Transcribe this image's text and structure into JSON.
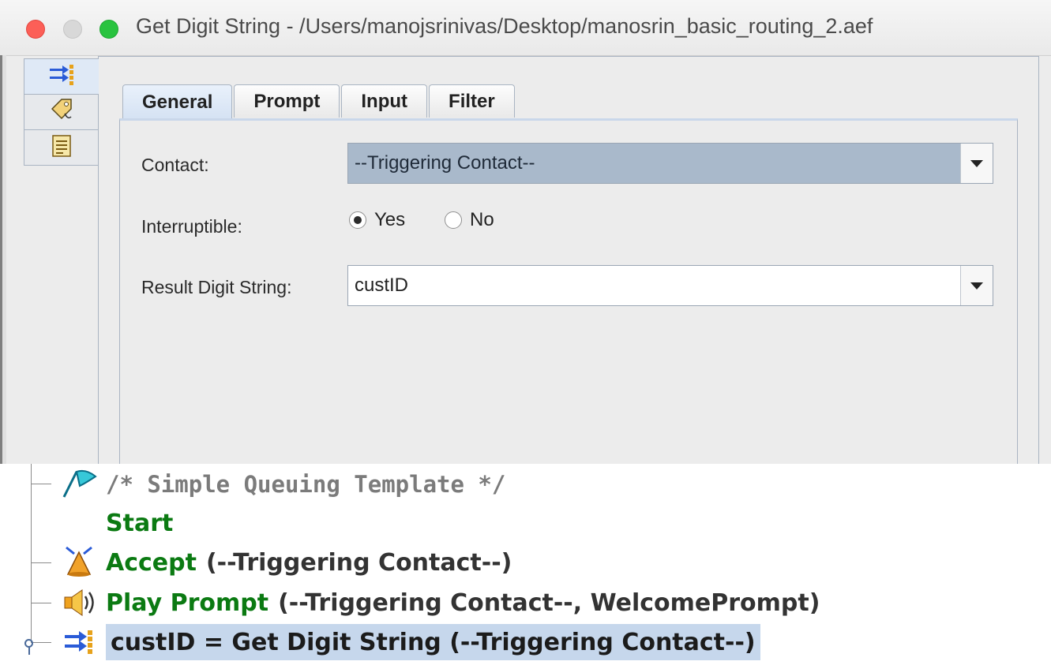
{
  "window": {
    "title": "Get Digit String - /Users/manojsrinivas/Desktop/manosrin_basic_routing_2.aef"
  },
  "side_tabs": [
    {
      "icon": "get-digit-icon"
    },
    {
      "icon": "tag-icon"
    },
    {
      "icon": "document-icon"
    }
  ],
  "tabs": [
    "General",
    "Prompt",
    "Input",
    "Filter"
  ],
  "general": {
    "contact_label": "Contact:",
    "contact_value": "--Triggering Contact--",
    "interruptible_label": "Interruptible:",
    "yes_label": "Yes",
    "no_label": "No",
    "interruptible_selected": "Yes",
    "result_label": "Result Digit String:",
    "result_value": "custID"
  },
  "tree": {
    "comment": "/* Simple Queuing Template */",
    "start": "Start",
    "accept_name": "Accept",
    "accept_args": "(--Triggering Contact--)",
    "play_name": "Play Prompt",
    "play_args": "(--Triggering Contact--, WelcomePrompt)",
    "selected_text": "custID = Get Digit String (--Triggering Contact--)"
  },
  "colors": {
    "step_name": "#0b7a12",
    "selection": "#c6d7ec",
    "contact_combo": "#a9b9cb"
  }
}
